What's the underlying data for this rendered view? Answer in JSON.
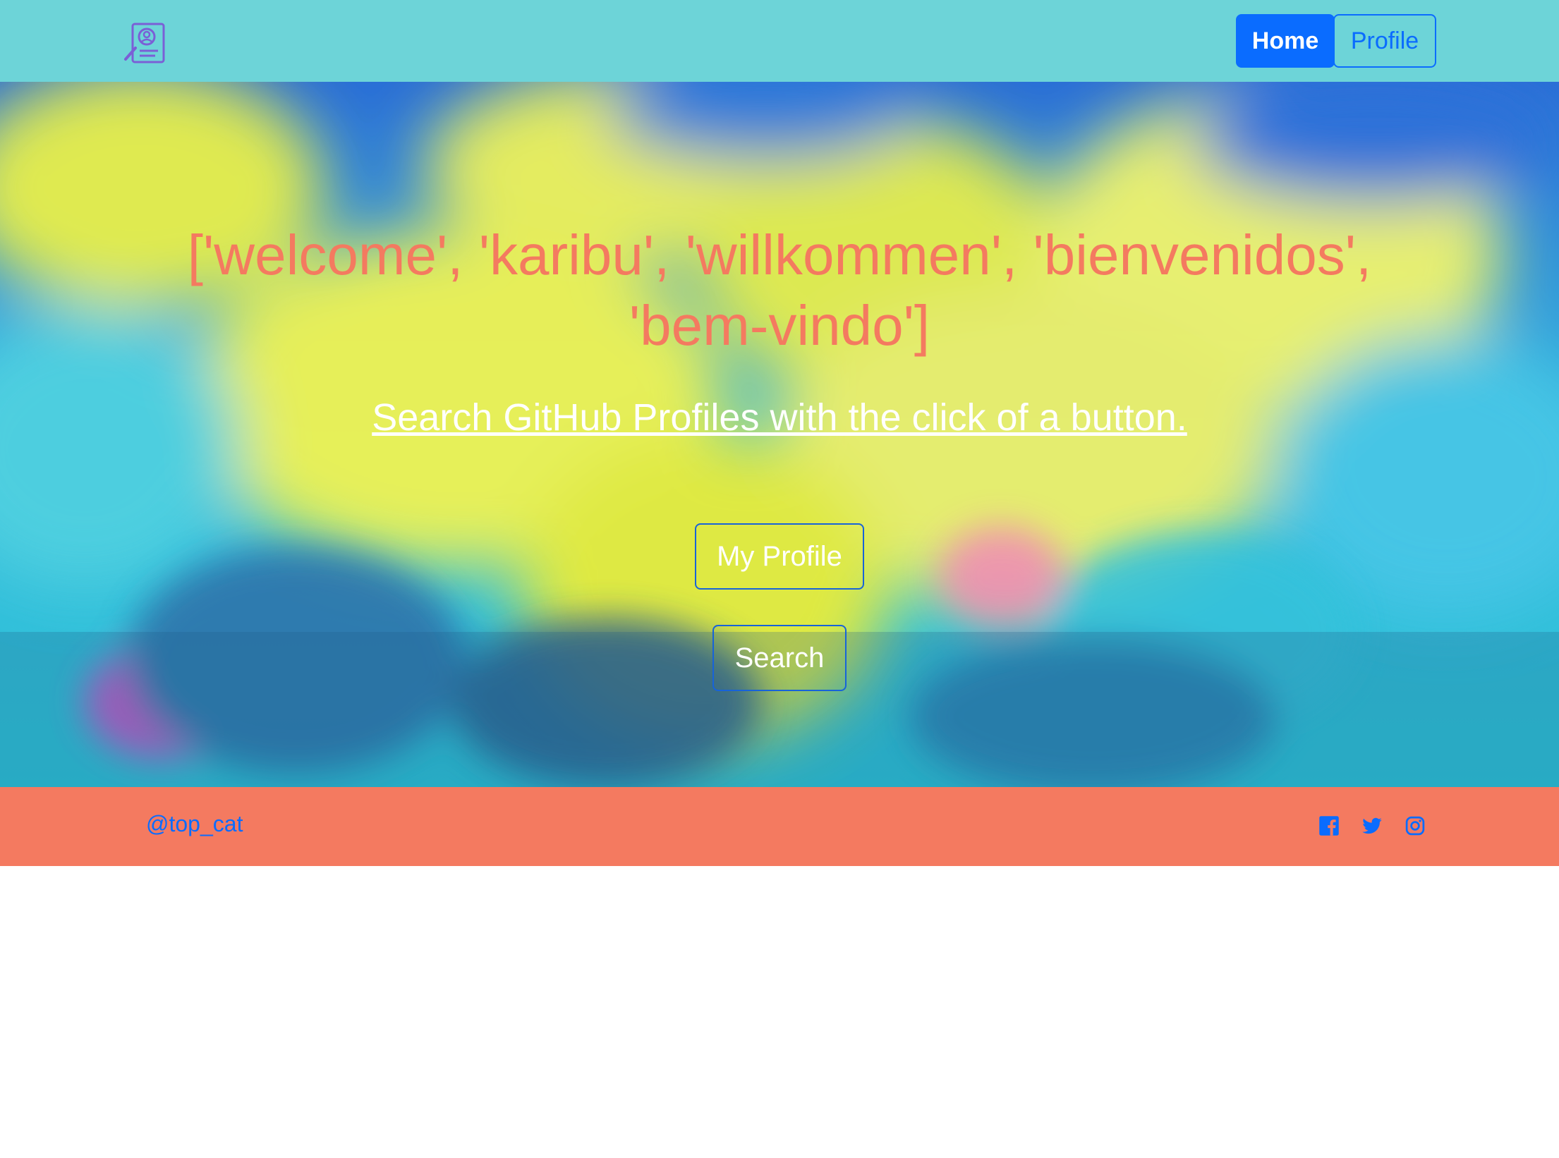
{
  "navbar": {
    "logo_icon": "profile-search-icon",
    "home_label": "Home",
    "profile_label": "Profile"
  },
  "hero": {
    "title": "['welcome', 'karibu', 'willkommen', 'bienvenidos', 'bem-vindo']",
    "tagline": "Search GitHub Profiles with the click of a button.",
    "my_profile_label": "My Profile",
    "search_label": "Search"
  },
  "footer": {
    "handle": "@top_cat",
    "social_icons": [
      "facebook-icon",
      "twitter-icon",
      "instagram-icon"
    ]
  },
  "colors": {
    "navbar_bg": "#6dd4d8",
    "accent_blue": "#0a6cff",
    "title_coral": "#f47a60",
    "footer_bg": "#f47a60"
  }
}
